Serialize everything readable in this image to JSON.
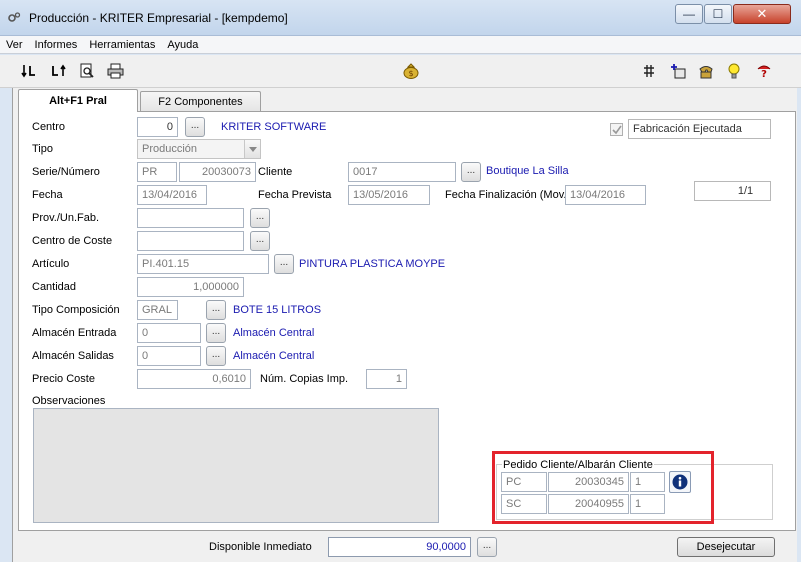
{
  "window": {
    "title": "Producción - KRITER Empresarial  - [kempdemo]",
    "minimize": "—",
    "maximize": "☐",
    "close": "✕"
  },
  "menu": [
    "Ver",
    "Informes",
    "Herramientas",
    "Ayuda"
  ],
  "toolbar": {
    "icons": [
      "sort-down-icon",
      "sort-up-icon",
      "print-preview-icon",
      "print-icon",
      "money-bag-icon",
      "grid-icon",
      "add-item-icon",
      "phone-icon",
      "lightbulb-icon",
      "help-icon"
    ]
  },
  "tabs": {
    "active": "Alt+F1 Pral",
    "inactive": "F2 Componentes"
  },
  "form": {
    "centro": {
      "label": "Centro",
      "value": "0",
      "desc": "KRITER SOFTWARE"
    },
    "fabricacion": {
      "label": "Fabricación Ejecutada",
      "checked": true
    },
    "tipo": {
      "label": "Tipo",
      "value": "Producción"
    },
    "serie": {
      "label": "Serie/Número",
      "serie": "PR",
      "numero": "20030073"
    },
    "cliente": {
      "label": "Cliente",
      "value": "0017",
      "desc": "Boutique La Silla"
    },
    "fecha": {
      "label": "Fecha",
      "value": "13/04/2016"
    },
    "fecha_prevista": {
      "label": "Fecha Prevista",
      "value": "13/05/2016"
    },
    "fecha_fin": {
      "label": "Fecha Finalización (Mov.",
      "value": "13/04/2016"
    },
    "pager": "1/1",
    "prov": {
      "label": "Prov./Un.Fab.",
      "value": ""
    },
    "centro_coste": {
      "label": "Centro de Coste",
      "value": ""
    },
    "articulo": {
      "label": "Artículo",
      "value": "PI.401.15",
      "desc": "PINTURA PLASTICA MOYPE"
    },
    "cantidad": {
      "label": "Cantidad",
      "value": "1,000000"
    },
    "tipo_comp": {
      "label": "Tipo Composición",
      "value": "GRAL",
      "desc": "BOTE 15 LITROS"
    },
    "alm_entrada": {
      "label": "Almacén Entrada",
      "value": "0",
      "desc": "Almacén Central"
    },
    "alm_salidas": {
      "label": "Almacén Salidas",
      "value": "0",
      "desc": "Almacén Central"
    },
    "precio": {
      "label": "Precio Coste",
      "value": "0,6010"
    },
    "copias": {
      "label": "Núm. Copias Imp.",
      "value": "1"
    },
    "observaciones": {
      "label": "Observaciones",
      "value": ""
    },
    "dots": "..."
  },
  "pedido": {
    "title": "Pedido Cliente/Albarán Cliente",
    "rows": [
      {
        "tipo": "PC",
        "numero": "20030345",
        "linea": "1"
      },
      {
        "tipo": "SC",
        "numero": "20040955",
        "linea": "1"
      }
    ]
  },
  "bottom": {
    "disponible_label": "Disponible Inmediato",
    "disponible_value": "90,0000",
    "desejecutar": "Desejecutar"
  },
  "colors": {
    "accent_red": "#e3232c",
    "link_blue": "#1a1ab0"
  }
}
